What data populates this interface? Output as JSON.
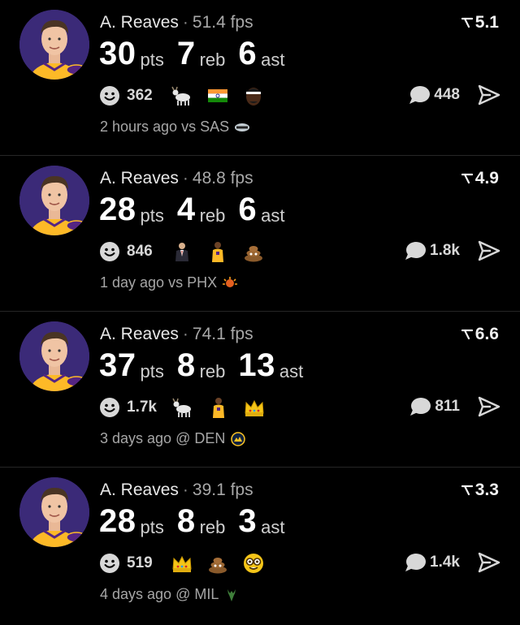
{
  "colors": {
    "background": "#000000",
    "divider": "#262626",
    "lakers_purple": "#552583",
    "lakers_gold": "#FDB927"
  },
  "feed": [
    {
      "player": "A. Reaves",
      "fps": "51.4 fps",
      "rating": "5.1",
      "pts": "30",
      "pts_label": "pts",
      "reb": "7",
      "reb_label": "reb",
      "ast": "6",
      "ast_label": "ast",
      "reaction_count": "362",
      "emojis": [
        "goat",
        "india-flag",
        "lebron-face"
      ],
      "comment_count": "448",
      "time": "2 hours ago",
      "matchup": "vs SAS",
      "opponent_icon": "spurs-logo"
    },
    {
      "player": "A. Reaves",
      "fps": "48.8 fps",
      "rating": "4.9",
      "pts": "28",
      "pts_label": "pts",
      "reb": "4",
      "reb_label": "reb",
      "ast": "6",
      "ast_label": "ast",
      "reaction_count": "846",
      "emojis": [
        "suit-man",
        "player-figure",
        "poop"
      ],
      "comment_count": "1.8k",
      "time": "1 day ago",
      "matchup": "vs PHX",
      "opponent_icon": "suns-logo"
    },
    {
      "player": "A. Reaves",
      "fps": "74.1 fps",
      "rating": "6.6",
      "pts": "37",
      "pts_label": "pts",
      "reb": "8",
      "reb_label": "reb",
      "ast": "13",
      "ast_label": "ast",
      "reaction_count": "1.7k",
      "emojis": [
        "goat",
        "player-figure",
        "crown"
      ],
      "comment_count": "811",
      "time": "3 days ago",
      "matchup": "@ DEN",
      "opponent_icon": "nuggets-logo"
    },
    {
      "player": "A. Reaves",
      "fps": "39.1 fps",
      "rating": "3.3",
      "pts": "28",
      "pts_label": "pts",
      "reb": "8",
      "reb_label": "reb",
      "ast": "3",
      "ast_label": "ast",
      "reaction_count": "519",
      "emojis": [
        "crown",
        "poop",
        "nerd-face"
      ],
      "comment_count": "1.4k",
      "time": "4 days ago",
      "matchup": "@ MIL",
      "opponent_icon": "bucks-logo"
    }
  ]
}
